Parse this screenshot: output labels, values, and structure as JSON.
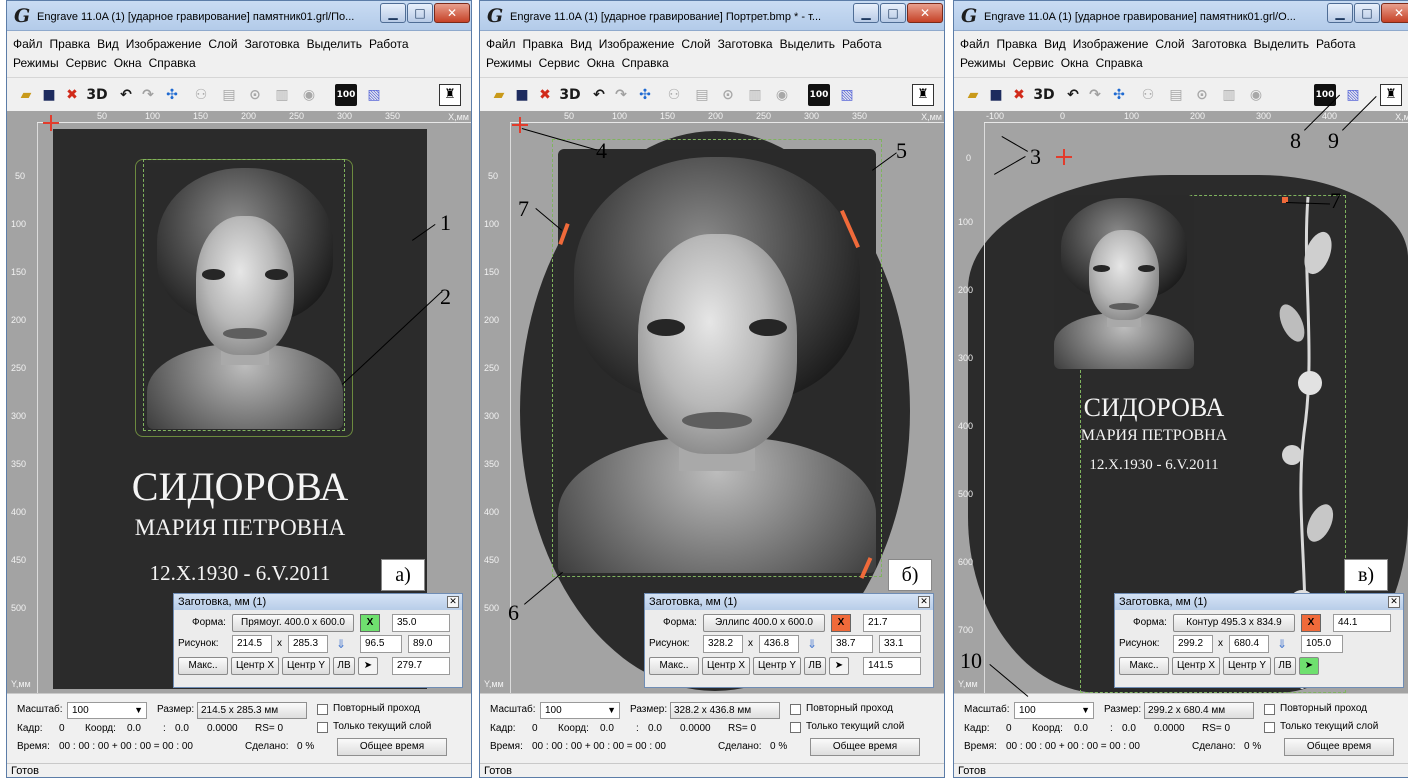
{
  "app": {
    "menu_row1": [
      "Файл",
      "Правка",
      "Вид",
      "Изображение",
      "Слой",
      "Заготовка",
      "Выделить",
      "Работа"
    ],
    "menu_row2": [
      "Режимы",
      "Сервис",
      "Окна",
      "Справка"
    ],
    "toolbar_labels": {
      "three_d": "3D",
      "hundred": "100"
    },
    "ready_status": "Готов"
  },
  "windows": [
    {
      "title": "Engrave 11.0A (1) [ударное гравирование] памятник01.grl/По...",
      "hruler": [
        "50",
        "100",
        "150",
        "200",
        "250",
        "300",
        "350",
        "Х,мм"
      ],
      "vruler": [
        "50",
        "100",
        "150",
        "200",
        "250",
        "300",
        "350",
        "400",
        "450",
        "500"
      ],
      "axis_y": "Y,мм",
      "epitaph": {
        "surname": "СИДОРОВА",
        "name": "МАРИЯ ПЕТРОВНА",
        "dates": "12.X.1930 - 6.V.2011"
      },
      "variant": "а)",
      "dialog": {
        "title": "Заготовка, мм (1)",
        "shape_label": "Форма:",
        "shape_value": "Прямоуг. 400.0 x 600.0",
        "x_button": "X",
        "x_color": "#6fe06f",
        "shape_param": "35.0",
        "image_label": "Рисунок:",
        "image_w": "214.5",
        "times": "x",
        "image_h": "285.3",
        "image_a": "96.5",
        "image_b": "89.0",
        "max_button": "Макс..",
        "center_x_button": "Центр X",
        "center_y_button": "Центр Y",
        "lv_button": "ЛВ",
        "cursor_color": "#f4f4f4",
        "extra": "279.7"
      },
      "status": {
        "scale_label": "Масштаб:",
        "scale_value": "100",
        "size_label": "Размер:",
        "size_value": "214.5 x 285.3 мм",
        "repeat_pass": "Повторный проход",
        "current_layer_only": "Только текущий слой",
        "frame_label": "Кадр:",
        "frame_value": "0",
        "coord_label": "Коорд:",
        "coord_x": "0.0",
        "colon": ":",
        "coord_y": "0.0",
        "coord_z": "0.0000",
        "rs": "RS= 0",
        "time_label": "Время:",
        "time_value": "00 : 00 : 00 + 00 : 00 = 00 : 00",
        "done_label": "Сделано:",
        "done_value": "0 %",
        "total_time_button": "Общее время"
      }
    },
    {
      "title": "Engrave 11.0A (1) [ударное гравирование] Портрет.bmp * - т...",
      "hruler": [
        "50",
        "100",
        "150",
        "200",
        "250",
        "300",
        "350",
        "Х,мм"
      ],
      "vruler": [
        "50",
        "100",
        "150",
        "200",
        "250",
        "300",
        "350",
        "400",
        "450",
        "500"
      ],
      "axis_y": "Y,мм",
      "variant": "б)",
      "dialog": {
        "title": "Заготовка, мм (1)",
        "shape_label": "Форма:",
        "shape_value": "Эллипс 400.0 x 600.0",
        "x_button": "X",
        "x_color": "#f06a3a",
        "shape_param": "21.7",
        "image_label": "Рисунок:",
        "image_w": "328.2",
        "times": "x",
        "image_h": "436.8",
        "image_a": "38.7",
        "image_b": "33.1",
        "max_button": "Макс..",
        "center_x_button": "Центр X",
        "center_y_button": "Центр Y",
        "lv_button": "ЛВ",
        "cursor_color": "#f4f4f4",
        "extra": "141.5"
      },
      "status": {
        "scale_label": "Масштаб:",
        "scale_value": "100",
        "size_label": "Размер:",
        "size_value": "328.2 x 436.8 мм",
        "repeat_pass": "Повторный проход",
        "current_layer_only": "Только текущий слой",
        "frame_label": "Кадр:",
        "frame_value": "0",
        "coord_label": "Коорд:",
        "coord_x": "0.0",
        "colon": ":",
        "coord_y": "0.0",
        "coord_z": "0.0000",
        "rs": "RS= 0",
        "time_label": "Время:",
        "time_value": "00 : 00 : 00 + 00 : 00 = 00 : 00",
        "done_label": "Сделано:",
        "done_value": "0 %",
        "total_time_button": "Общее время"
      }
    },
    {
      "title": "Engrave 11.0A (1) [ударное гравирование] памятник01.grl/О...",
      "hruler": [
        "-100",
        "0",
        "100",
        "200",
        "300",
        "400",
        "Х,мм"
      ],
      "vruler": [
        "0",
        "100",
        "200",
        "300",
        "400",
        "500",
        "600",
        "700"
      ],
      "axis_y": "Y,мм",
      "epitaph": {
        "surname": "СИДОРОВА",
        "name": "МАРИЯ ПЕТРОВНА",
        "dates": "12.X.1930 - 6.V.2011"
      },
      "variant": "в)",
      "dialog": {
        "title": "Заготовка, мм (1)",
        "shape_label": "Форма:",
        "shape_value": "Контур 495.3 x 834.9",
        "x_button": "X",
        "x_color": "#f06a3a",
        "shape_param": "44.1",
        "image_label": "Рисунок:",
        "image_w": "299.2",
        "times": "x",
        "image_h": "680.4",
        "image_a": "105.0",
        "image_b": "",
        "max_button": "Макс..",
        "center_x_button": "Центр X",
        "center_y_button": "Центр Y",
        "lv_button": "ЛВ",
        "cursor_color": "#6fe06f",
        "extra": ""
      },
      "status": {
        "scale_label": "Масштаб:",
        "scale_value": "100",
        "size_label": "Размер:",
        "size_value": "299.2 x 680.4 мм",
        "repeat_pass": "Повторный проход",
        "current_layer_only": "Только текущий слой",
        "frame_label": "Кадр:",
        "frame_value": "0",
        "coord_label": "Коорд:",
        "coord_x": "0.0",
        "colon": ":",
        "coord_y": "0.0",
        "coord_z": "0.0000",
        "rs": "RS= 0",
        "time_label": "Время:",
        "time_value": "00 : 00 : 00 + 00 : 00 = 00 : 00",
        "done_label": "Сделано:",
        "done_value": "0 %",
        "total_time_button": "Общее время"
      }
    }
  ],
  "callouts": [
    "1",
    "2",
    "3",
    "4",
    "5",
    "6",
    "7",
    "7",
    "8",
    "9",
    "10"
  ],
  "colors": {
    "blank": "#2b2b2b",
    "workspace": "#a3a3a3",
    "cross": "#e23c2c",
    "guide": "#7fb35e",
    "accent_orange": "#f06a3a"
  }
}
